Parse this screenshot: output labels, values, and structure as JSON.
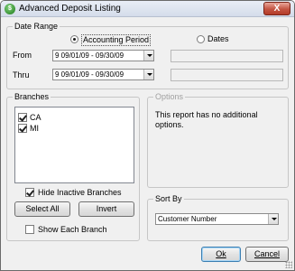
{
  "window": {
    "title": "Advanced Deposit Listing",
    "close_glyph": "X"
  },
  "date_range": {
    "label": "Date Range",
    "accounting_period_label": "Accounting Period",
    "dates_label": "Dates",
    "selected": "Accounting Period",
    "from_label": "From",
    "from_value": "9  09/01/09 - 09/30/09",
    "thru_label": "Thru",
    "thru_value": "9  09/01/09 - 09/30/09"
  },
  "branches": {
    "label": "Branches",
    "items": [
      {
        "label": "CA",
        "checked": true
      },
      {
        "label": "MI",
        "checked": true
      }
    ],
    "hide_inactive_label": "Hide Inactive Branches",
    "hide_inactive_checked": true,
    "select_all_label": "Select All",
    "invert_label": "Invert",
    "show_each_label": "Show Each Branch",
    "show_each_checked": false
  },
  "options": {
    "label": "Options",
    "message": "This report has no additional options."
  },
  "sort_by": {
    "label": "Sort By",
    "value": "Customer Number"
  },
  "buttons": {
    "ok_label": "Ok",
    "cancel_label": "Cancel"
  }
}
